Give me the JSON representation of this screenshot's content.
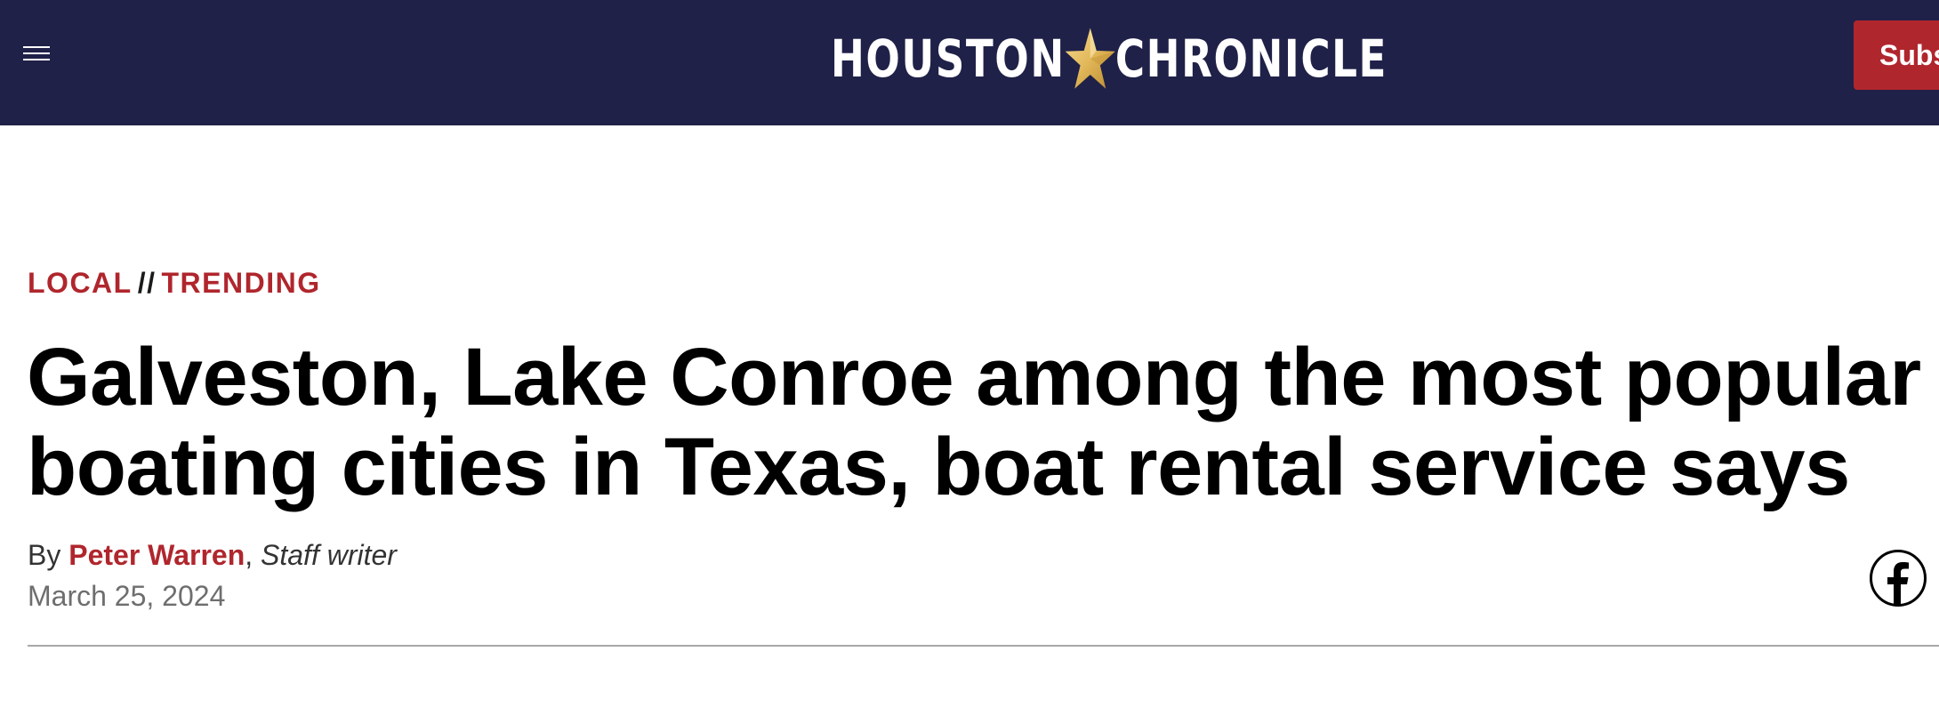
{
  "header": {
    "logo_left": "HOUSTON",
    "logo_right": "CHRONICLE",
    "subscribe_label": "Subscribe",
    "colors": {
      "bar": "#1f2148",
      "accent": "#b0262d",
      "star": "#e2b85a"
    }
  },
  "article": {
    "category_primary": "LOCAL",
    "category_separator": "//",
    "category_secondary": "TRENDING",
    "headline_line1": "Galveston, Lake Conroe among the most popular",
    "headline_line2": "boating cities in Texas, boat rental service says",
    "byline_prefix": "By",
    "author": "Peter Warren",
    "author_separator": ",",
    "author_role": "Staff writer",
    "date": "March 25, 2024"
  },
  "icons": {
    "menu": "hamburger-menu-icon",
    "star": "star-icon",
    "share_facebook": "facebook-icon"
  }
}
